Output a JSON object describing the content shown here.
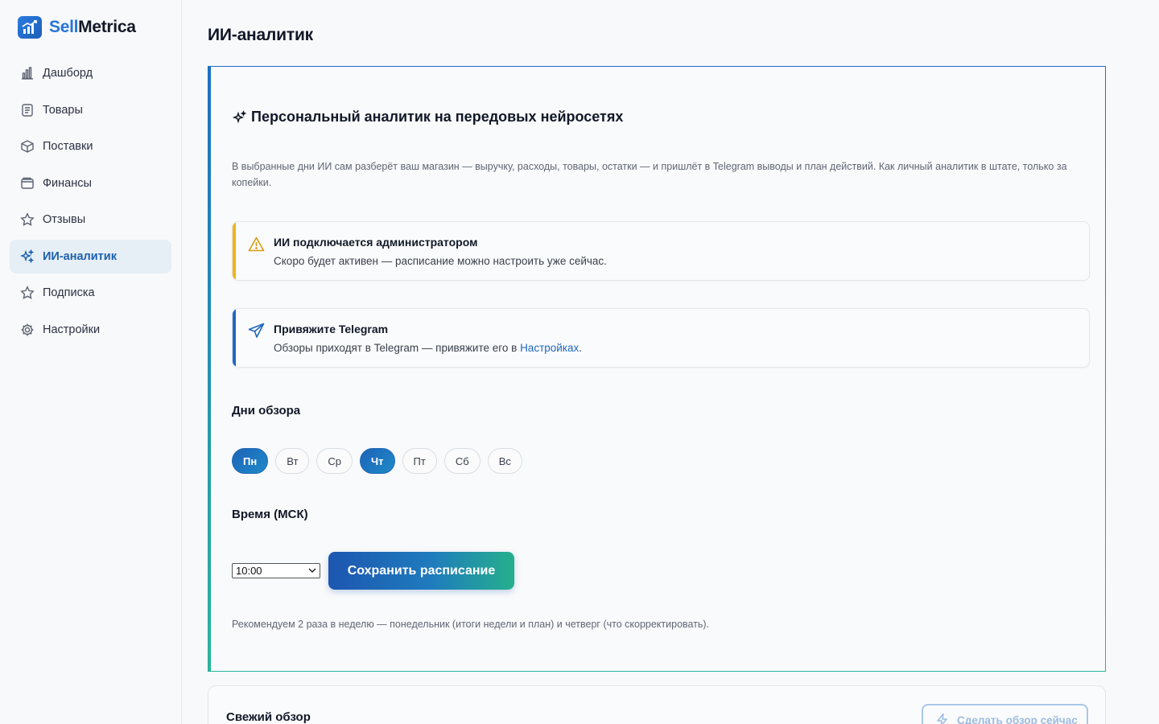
{
  "brand": {
    "name_part1": "Sell",
    "name_part2": "Metrica",
    "icon": "chart-logo-icon"
  },
  "sidebar": {
    "items": [
      {
        "label": "Дашборд",
        "icon": "bar-chart-icon",
        "active": false
      },
      {
        "label": "Товары",
        "icon": "clipboard-icon",
        "active": false
      },
      {
        "label": "Поставки",
        "icon": "box-icon",
        "active": false
      },
      {
        "label": "Финансы",
        "icon": "wallet-icon",
        "active": false
      },
      {
        "label": "Отзывы",
        "icon": "star-icon",
        "active": false
      },
      {
        "label": "ИИ-аналитик",
        "icon": "sparkles-icon",
        "active": true
      },
      {
        "label": "Подписка",
        "icon": "star-icon",
        "active": false
      },
      {
        "label": "Настройки",
        "icon": "gear-icon",
        "active": false
      }
    ]
  },
  "page": {
    "title": "ИИ-аналитик"
  },
  "analyst": {
    "title": "Персональный аналитик на передовых нейросетях",
    "description": "В выбранные дни ИИ сам разберёт ваш магазин — выручку, расходы, товары, остатки — и пришлёт в Telegram выводы и план действий. Как личный аналитик в штате, только за копейки.",
    "warning": {
      "title": "ИИ подключается администратором",
      "text": "Скоро будет активен — расписание можно настроить уже сейчас."
    },
    "telegram": {
      "title": "Привяжите Telegram",
      "text": "Обзоры приходят в Telegram — привяжите его в ",
      "link": "Настройках",
      "suffix": "."
    },
    "days_label": "Дни обзора",
    "days": [
      {
        "label": "Пн",
        "selected": true
      },
      {
        "label": "Вт",
        "selected": false
      },
      {
        "label": "Ср",
        "selected": false
      },
      {
        "label": "Чт",
        "selected": true
      },
      {
        "label": "Пт",
        "selected": false
      },
      {
        "label": "Сб",
        "selected": false
      },
      {
        "label": "Вс",
        "selected": false
      }
    ],
    "time_label": "Время (МСК)",
    "time_value": "10:00",
    "save_label": "Сохранить расписание",
    "hint": "Рекомендуем 2 раза в неделю — понедельник (итоги недели и план) и четверг (что скорректировать)."
  },
  "fresh": {
    "title": "Свежий обзор",
    "button": "Сделать обзор сейчас"
  },
  "colors": {
    "accent": "#1e63b8",
    "accent_green": "#25b08c",
    "warning": "#f2b320"
  }
}
